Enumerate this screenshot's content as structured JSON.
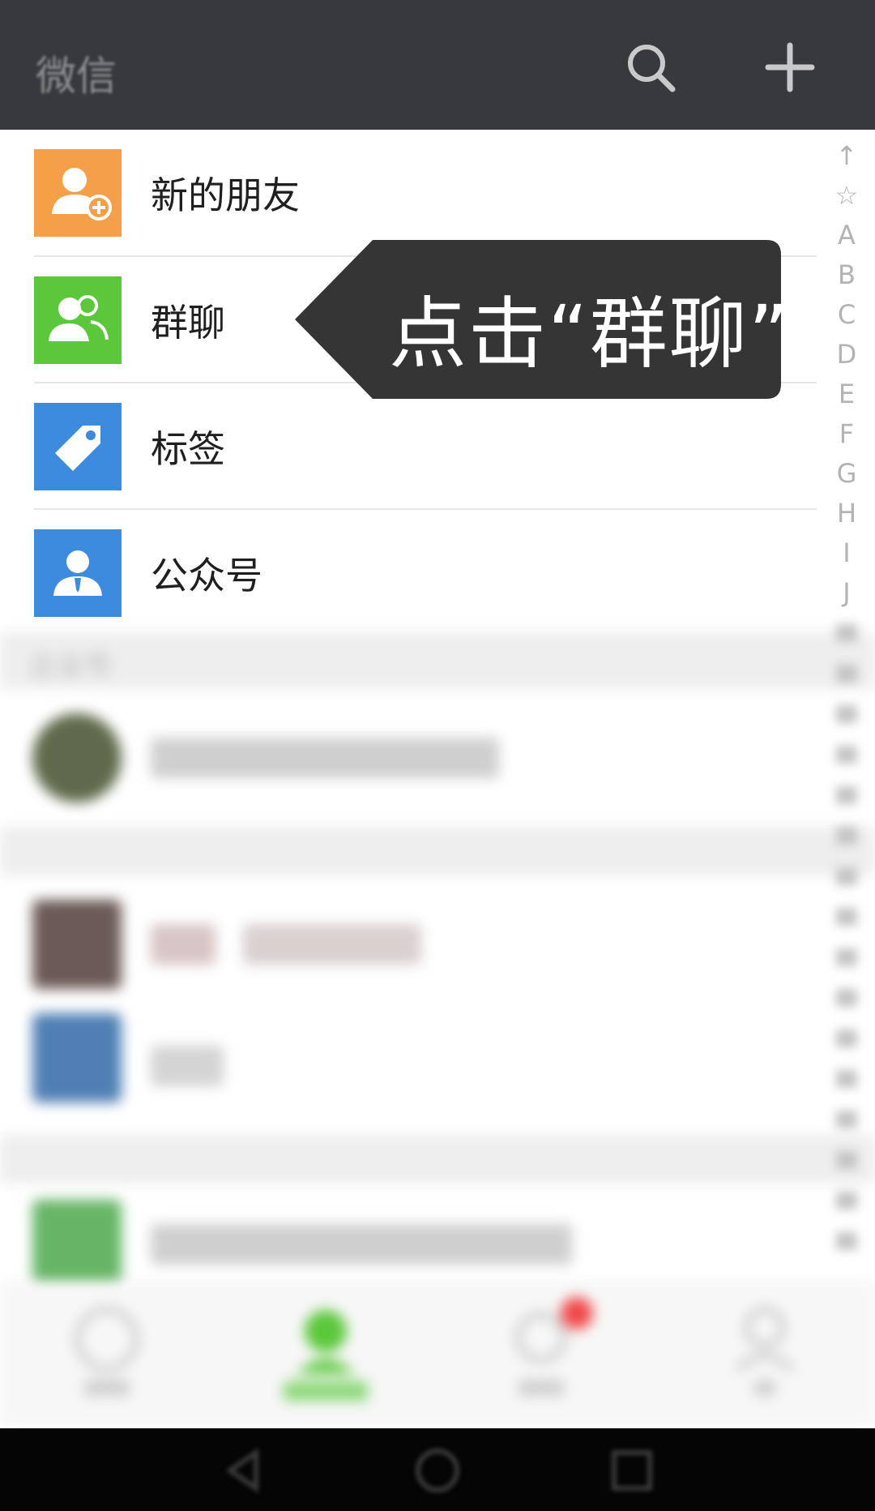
{
  "header": {
    "title": "微信",
    "search_icon": "search-icon",
    "add_icon": "plus-icon"
  },
  "menu": {
    "items": [
      {
        "label": "新的朋友",
        "icon": "new-friend-icon",
        "color": "#f5a049"
      },
      {
        "label": "群聊",
        "icon": "group-chat-icon",
        "color": "#5ac83a"
      },
      {
        "label": "标签",
        "icon": "tag-icon",
        "color": "#3d8bde"
      },
      {
        "label": "公众号",
        "icon": "official-account-icon",
        "color": "#3d8bde"
      }
    ]
  },
  "sections": {
    "enterprise_label": "企业号"
  },
  "tooltip": {
    "text": "点击“群聊”"
  },
  "alphabet": [
    "↑",
    "☆",
    "A",
    "B",
    "C",
    "D",
    "E",
    "F",
    "G",
    "H",
    "I",
    "J"
  ]
}
